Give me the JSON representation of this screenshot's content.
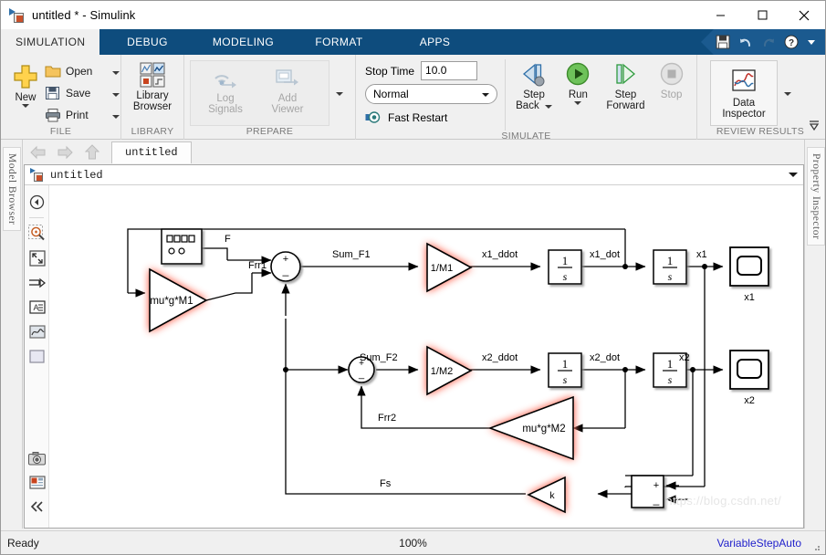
{
  "window": {
    "title": "untitled * - Simulink",
    "icon": "simulink-model-icon",
    "minimize": "minimize-icon",
    "maximize": "maximize-icon",
    "close": "close-icon"
  },
  "ribbon_tabs": [
    {
      "label": "SIMULATION",
      "active": true
    },
    {
      "label": "DEBUG",
      "active": false
    },
    {
      "label": "MODELING",
      "active": false
    },
    {
      "label": "FORMAT",
      "active": false
    },
    {
      "label": "APPS",
      "active": false
    }
  ],
  "quick_access": [
    {
      "name": "save-icon"
    },
    {
      "name": "undo-icon"
    },
    {
      "name": "redo-icon"
    },
    {
      "name": "help-icon"
    },
    {
      "name": "qat-dropdown-icon"
    }
  ],
  "ribbon": {
    "file_group": {
      "label": "FILE",
      "new_label": "New",
      "open_label": "Open",
      "save_label": "Save",
      "print_label": "Print"
    },
    "library_group": {
      "label": "LIBRARY",
      "library_browser_line1": "Library",
      "library_browser_line2": "Browser"
    },
    "prepare_group": {
      "label": "PREPARE",
      "log_signals_line1": "Log",
      "log_signals_line2": "Signals",
      "add_viewer_line1": "Add",
      "add_viewer_line2": "Viewer"
    },
    "simulate_group": {
      "label": "SIMULATE",
      "stop_time_label": "Stop Time",
      "stop_time_value": "10.0",
      "sim_mode_value": "Normal",
      "fast_restart_label": "Fast Restart",
      "step_back_line1": "Step",
      "step_back_line2": "Back",
      "run_label": "Run",
      "step_forward_line1": "Step",
      "step_forward_line2": "Forward",
      "stop_label": "Stop"
    },
    "review_group": {
      "label": "REVIEW RESULTS",
      "data_inspector_line1": "Data",
      "data_inspector_line2": "Inspector"
    }
  },
  "nav": {
    "back": "back-arrow-icon",
    "forward": "forward-arrow-icon",
    "up": "up-arrow-icon",
    "document_tab": "untitled"
  },
  "side_panels": {
    "left_label": "Model Browser",
    "right_label": "Property Inspector"
  },
  "breadcrumb": {
    "path": "untitled"
  },
  "palette": [
    {
      "name": "navigate-back-icon"
    },
    {
      "name": "zoom-in-icon"
    },
    {
      "name": "fit-to-view-icon"
    },
    {
      "name": "signal-routing-icon"
    },
    {
      "name": "annotation-icon"
    },
    {
      "name": "scope-preview-icon"
    },
    {
      "name": "area-block-icon"
    },
    {
      "name": "camera-snapshot-icon"
    },
    {
      "name": "report-icon"
    },
    {
      "name": "collapse-palette-icon"
    }
  ],
  "diagram": {
    "blocks": [
      {
        "id": "signal_builder",
        "type": "signal-builder",
        "label": ""
      },
      {
        "id": "gain_murgM1",
        "type": "gain-triangle",
        "label": "mu*g*M1",
        "highlighted": true
      },
      {
        "id": "sum1",
        "type": "sum-round",
        "signs": [
          "+",
          "−",
          "+"
        ]
      },
      {
        "id": "gain_1M1",
        "type": "gain-triangle",
        "label": "1/M1",
        "highlighted": true
      },
      {
        "id": "int1a",
        "type": "integrator",
        "label_num": "1",
        "label_den": "s"
      },
      {
        "id": "int1b",
        "type": "integrator",
        "label_num": "1",
        "label_den": "s"
      },
      {
        "id": "scope_x1",
        "type": "scope",
        "caption": "x1"
      },
      {
        "id": "sum2",
        "type": "sum-round",
        "signs": [
          "+",
          "−"
        ]
      },
      {
        "id": "gain_1M2",
        "type": "gain-triangle",
        "label": "1/M2",
        "highlighted": true
      },
      {
        "id": "int2a",
        "type": "integrator",
        "label_num": "1",
        "label_den": "s"
      },
      {
        "id": "int2b",
        "type": "integrator",
        "label_num": "1",
        "label_den": "s"
      },
      {
        "id": "scope_x2",
        "type": "scope",
        "caption": "x2"
      },
      {
        "id": "gain_murgM2",
        "type": "gain-triangle-left",
        "label": "mu*g*M2",
        "highlighted": true
      },
      {
        "id": "gain_k",
        "type": "gain-triangle-left",
        "label": "k",
        "highlighted": true
      },
      {
        "id": "sum3",
        "type": "sum-rect",
        "signs": [
          "+",
          "−"
        ]
      }
    ],
    "signal_labels": [
      "F",
      "Frr1",
      "Sum_F1",
      "x1_ddot",
      "x1_dot",
      "x1",
      "Sum_F2",
      "x2_ddot",
      "x2_dot",
      "x2",
      "Frr2",
      "Fs"
    ],
    "scope_captions": [
      "x1",
      "x2"
    ],
    "highlight_color": "#ff9a8e"
  },
  "status": {
    "ready": "Ready",
    "zoom": "100%",
    "solver": "VariableStepAuto"
  },
  "watermark": "https://blog.csdn.net/"
}
